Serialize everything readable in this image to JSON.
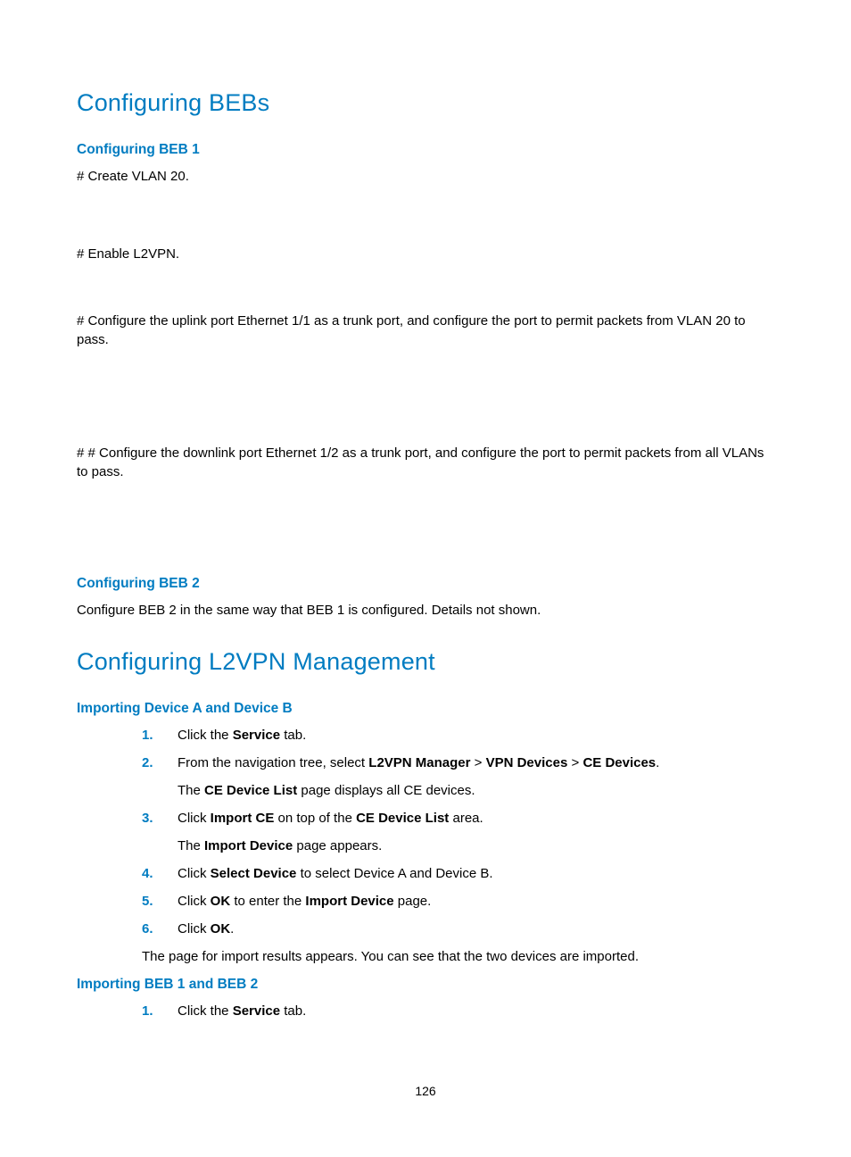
{
  "h1_bebs": "Configuring BEBs",
  "h2_beb1": "Configuring BEB 1",
  "beb1_p1": "# Create VLAN 20.",
  "beb1_p2": "# Enable L2VPN.",
  "beb1_p3": "# Configure the uplink port Ethernet 1/1 as a trunk port, and configure the port to permit packets from VLAN 20 to pass.",
  "beb1_p4": "# # Configure the downlink port Ethernet 1/2 as a trunk port, and configure the port to permit packets from all VLANs to pass.",
  "h2_beb2": "Configuring BEB 2",
  "beb2_p1": "Configure BEB 2 in the same way that BEB 1 is configured. Details not shown.",
  "h1_l2vpn": "Configuring L2VPN Management",
  "h2_importAB": "Importing Device A and Device B",
  "steps_ab": {
    "n1": "1.",
    "n2": "2.",
    "n3": "3.",
    "n4": "4.",
    "n5": "5.",
    "n6": "6.",
    "s1_a": "Click the ",
    "s1_b": "Service",
    "s1_c": " tab.",
    "s2_a": "From the navigation tree, select ",
    "s2_b": "L2VPN Manager",
    "s2_c": " > ",
    "s2_d": "VPN Devices",
    "s2_e": " > ",
    "s2_f": "CE Devices",
    "s2_g": ".",
    "s2_sub_a": "The ",
    "s2_sub_b": "CE Device List",
    "s2_sub_c": " page displays all CE devices.",
    "s3_a": "Click ",
    "s3_b": "Import CE",
    "s3_c": " on top of the ",
    "s3_d": "CE Device List",
    "s3_e": " area.",
    "s3_sub_a": "The ",
    "s3_sub_b": "Import Device",
    "s3_sub_c": " page appears.",
    "s4_a": "Click ",
    "s4_b": "Select Device",
    "s4_c": " to select Device A and Device B.",
    "s5_a": "Click ",
    "s5_b": "OK",
    "s5_c": " to enter the ",
    "s5_d": "Import Device",
    "s5_e": " page.",
    "s6_a": "Click ",
    "s6_b": "OK",
    "s6_c": ".",
    "after": "The page for import results appears. You can see that the two devices are imported."
  },
  "h2_importBEB": "Importing BEB 1 and BEB 2",
  "steps_beb": {
    "n1": "1.",
    "s1_a": "Click the ",
    "s1_b": "Service",
    "s1_c": " tab."
  },
  "pagenum": "126"
}
